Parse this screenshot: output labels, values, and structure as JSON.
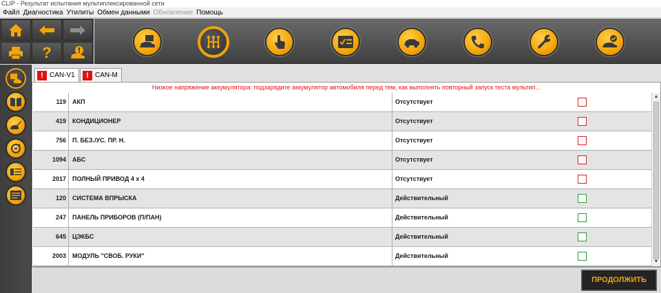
{
  "window": {
    "title": "CLIP - Результат испытания мультиплексированной сети"
  },
  "menu": [
    {
      "label": "Файл",
      "disabled": false
    },
    {
      "label": "Диагностика",
      "disabled": false
    },
    {
      "label": "Утилиты",
      "disabled": false
    },
    {
      "label": "Обмен данными",
      "disabled": false
    },
    {
      "label": "Обновление",
      "disabled": true
    },
    {
      "label": "Помощь",
      "disabled": false
    }
  ],
  "left_toolbar": {
    "icons": [
      "home-icon",
      "back-arrow-icon",
      "forward-arrow-icon",
      "printer-icon",
      "help-icon",
      "vehicle-alert-icon"
    ],
    "help_glyph": "?"
  },
  "main_toolbar": {
    "icons": [
      "vehicle-identification-icon",
      "gearbox-icon",
      "touch-icon",
      "checklist-icon",
      "vehicle-scan-icon",
      "phone-support-icon",
      "wrench-icon",
      "vehicle-check-icon"
    ],
    "active_index": 1
  },
  "sidebar": {
    "icons": [
      "network-test-icon",
      "manual-book-icon",
      "edit-vehicle-icon",
      "reset-cycle-icon",
      "wiring-icon",
      "report-icon"
    ],
    "active_index": 0
  },
  "tabs": [
    {
      "label": "CAN-V1",
      "selected": true,
      "warn_glyph": "!"
    },
    {
      "label": "CAN-M",
      "selected": false,
      "warn_glyph": "!"
    }
  ],
  "warning_message": "Низкое напряжение аккумулятора: подзарядите аккумулятор автомобиля перед тем, как выполнять повторный запуск теста мультип...",
  "table": {
    "rows": [
      {
        "id": "119",
        "name": "АКП",
        "status": "Отсутствует",
        "ok": false
      },
      {
        "id": "419",
        "name": "КОНДИЦИОНЕР",
        "status": "Отсутствует",
        "ok": false
      },
      {
        "id": "756",
        "name": "П. БЕЗ./УС. ПР. Н.",
        "status": "Отсутствует",
        "ok": false
      },
      {
        "id": "1094",
        "name": "АБС",
        "status": "Отсутствует",
        "ok": false
      },
      {
        "id": "2017",
        "name": "ПОЛНЫЙ ПРИВОД 4 х 4",
        "status": "Отсутствует",
        "ok": false
      },
      {
        "id": "120",
        "name": "СИСТЕМА ВПРЫСКА",
        "status": "Действительный",
        "ok": true
      },
      {
        "id": "247",
        "name": "ПАНЕЛЬ ПРИБОРОВ (П/ПАН)",
        "status": "Действительный",
        "ok": true
      },
      {
        "id": "645",
        "name": "ЦЭКБС",
        "status": "Действительный",
        "ok": true
      },
      {
        "id": "2003",
        "name": "МОДУЛЬ \"СВОБ. РУКИ\"",
        "status": "Действительный",
        "ok": true
      }
    ]
  },
  "scrollbar": {
    "up_glyph": "▲",
    "down_glyph": "▼"
  },
  "continue_button": {
    "label": "ПРОДОЛЖИТЬ"
  },
  "colors": {
    "accent": "#f4a40a",
    "warning_text": "#e81010",
    "absent_box": "#d82020",
    "valid_box": "#2a9a2a"
  }
}
